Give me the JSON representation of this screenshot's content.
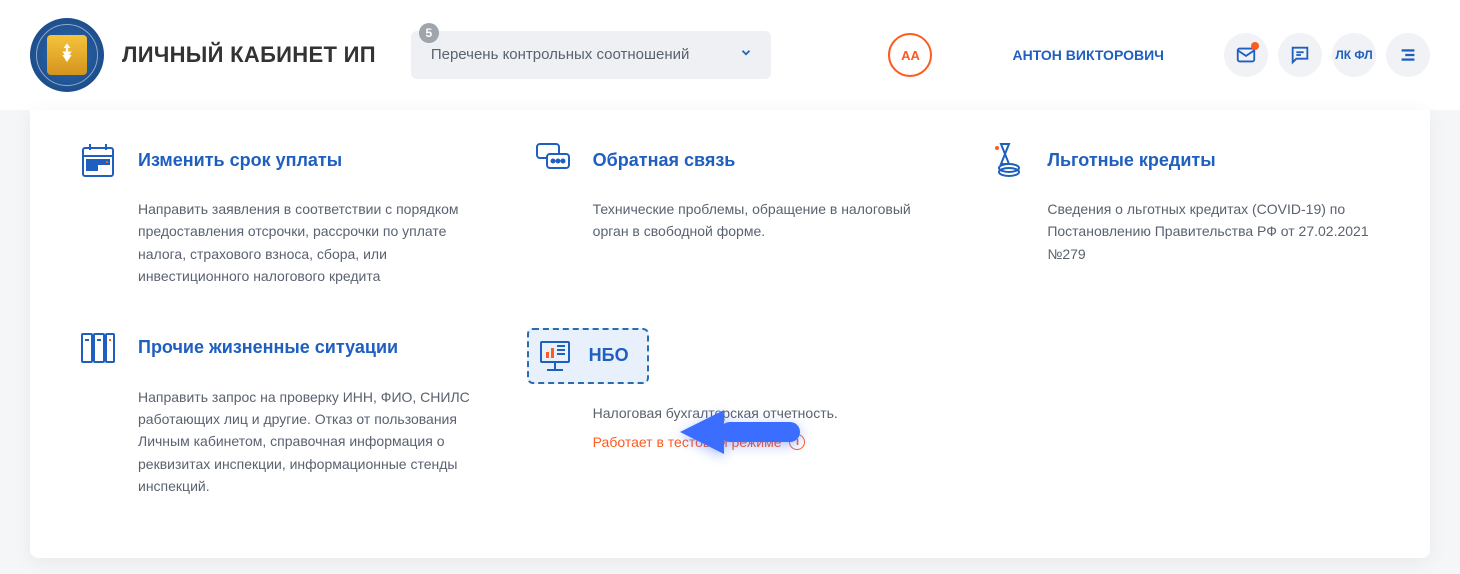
{
  "header": {
    "app_title": "ЛИЧНЫЙ КАБИНЕТ ИП",
    "dropdown": {
      "badge": "5",
      "label": "Перечень контрольных соотношений"
    },
    "aa_label": "АА",
    "username": "АНТОН ВИКТОРОВИЧ",
    "lk_fl": "ЛК ФЛ"
  },
  "tiles": {
    "pay_term": {
      "title": "Изменить срок уплаты",
      "desc": "Направить заявления в соответствии с порядком предоставления отсрочки, рассрочки по уплате налога, страхового взноса, сбора, или инвестиционного налогового кредита"
    },
    "feedback": {
      "title": "Обратная связь",
      "desc": "Технические проблемы, обращение в налоговый орган в свободной форме."
    },
    "loans": {
      "title": "Льготные кредиты",
      "desc": "Сведения о льготных кредитах (COVID-19) по Постановлению Правительства РФ от 27.02.2021 №279"
    },
    "other": {
      "title": "Прочие жизненные ситуации",
      "desc": "Направить запрос на проверку ИНН, ФИО, СНИЛС работающих лиц и другие. Отказ от пользования Личным кабинетом, справочная информация о реквизитах инспекции, информационные стенды инспекций."
    },
    "nbo": {
      "title": "НБО",
      "desc": "Налоговая бухгалтерская отчетность.",
      "warn": "Работает в тестовом режиме",
      "info_glyph": "i"
    }
  }
}
